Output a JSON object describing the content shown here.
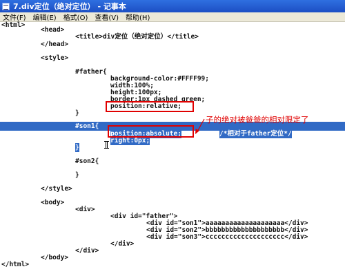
{
  "window": {
    "title": "7.div定位（绝对定位） - 记事本"
  },
  "menu": [
    "文件(F)",
    "编辑(E)",
    "格式(O)",
    "查看(V)",
    "帮助(H)"
  ],
  "code": [
    "<html>",
    "<head>",
    "<title>div定位（绝对定位）</title>",
    "</head>",
    "<style>",
    "#father{",
    "background-color:#FFFF99;",
    "width:100%;",
    "height:100px;",
    "border:1px dashed green;",
    "position:relative;",
    "}",
    "#son1{",
    "position:absolute;",
    "/*相对于father定位*/",
    "right:0px;",
    "}",
    "#son2{",
    "}",
    "</style>",
    "<body>",
    "<div>",
    "<div id=\"father\">",
    "<div id=\"son1\">aaaaaaaaaaaaaaaaaaaa</div>",
    "<div id=\"son2\">bbbbbbbbbbbbbbbbbbbb</div>",
    "<div id=\"son3\">cccccccccccccccccccc</div>",
    "</div>",
    "</div>",
    "</body>",
    "</html>"
  ],
  "annotation": "子的绝对被爸爸的相对限定了",
  "colors": {
    "selection": "#316ac5",
    "highlight_box": "#e00000",
    "title_bar": "#1c4fc4"
  }
}
